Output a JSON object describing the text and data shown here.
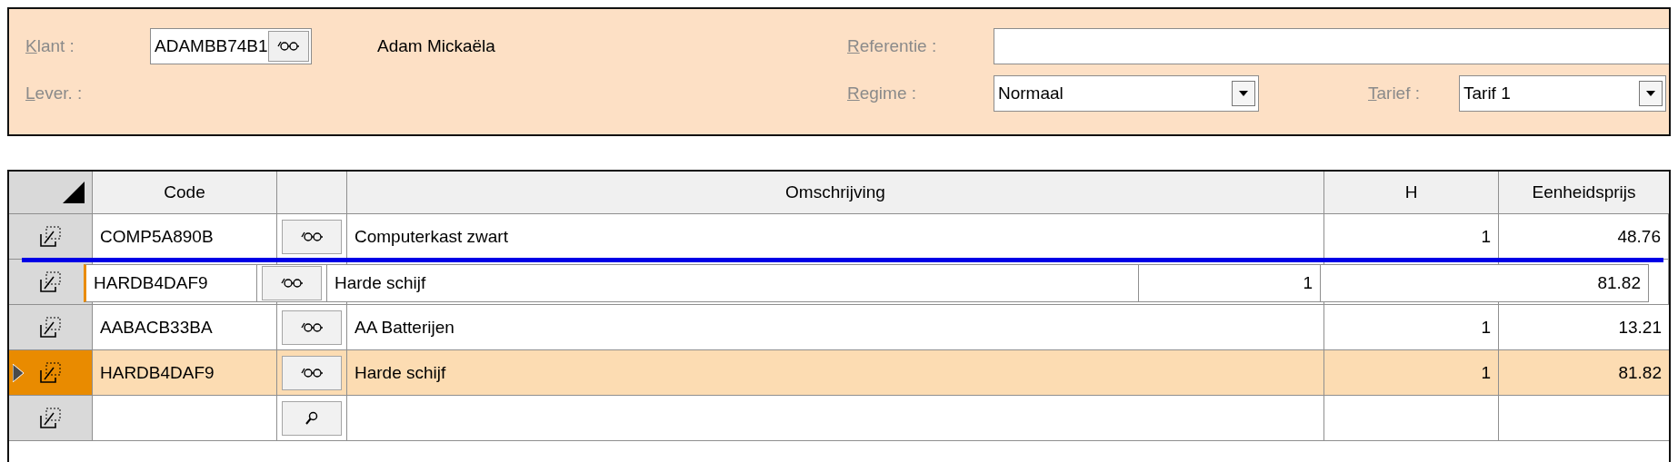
{
  "header": {
    "customer": {
      "label": "Klant :",
      "code": "ADAMBB74B1",
      "name": "Adam Mickaëla"
    },
    "delivery": {
      "label": "Lever. :"
    },
    "reference": {
      "label": "Referentie :"
    },
    "regime": {
      "label": "Regime :",
      "value": "Normaal"
    },
    "tariff": {
      "label": "Tarief :",
      "value": "Tarif 1"
    }
  },
  "grid": {
    "columns": [
      {
        "label": "Code"
      },
      {},
      {
        "label": "Omschrijving"
      },
      {
        "label": "H"
      },
      {
        "label": "Eenheidsprijs"
      }
    ],
    "rows": [
      {
        "kind": "item",
        "code": "COMP5A890B",
        "description": "Computerkast zwart",
        "quantity": "1",
        "unit_price": "48.76",
        "selected": false,
        "drop_line_below": true
      },
      {
        "kind": "covered",
        "selected": false,
        "drop_line_below": false
      },
      {
        "kind": "item",
        "code": "AABACB33BA",
        "description": "AA Batterijen",
        "quantity": "1",
        "unit_price": "13.21",
        "selected": false,
        "drop_line_below": false
      },
      {
        "kind": "item",
        "code": "HARDB4DAF9",
        "description": "Harde schijf",
        "quantity": "1",
        "unit_price": "81.82",
        "selected": true,
        "drop_line_below": false
      },
      {
        "kind": "new",
        "selected": false,
        "drop_line_below": false
      }
    ],
    "dragged_row": {
      "kind": "item",
      "code": "HARDB4DAF9",
      "description": "Harde schijf",
      "quantity": "1",
      "unit_price": "81.82"
    }
  }
}
